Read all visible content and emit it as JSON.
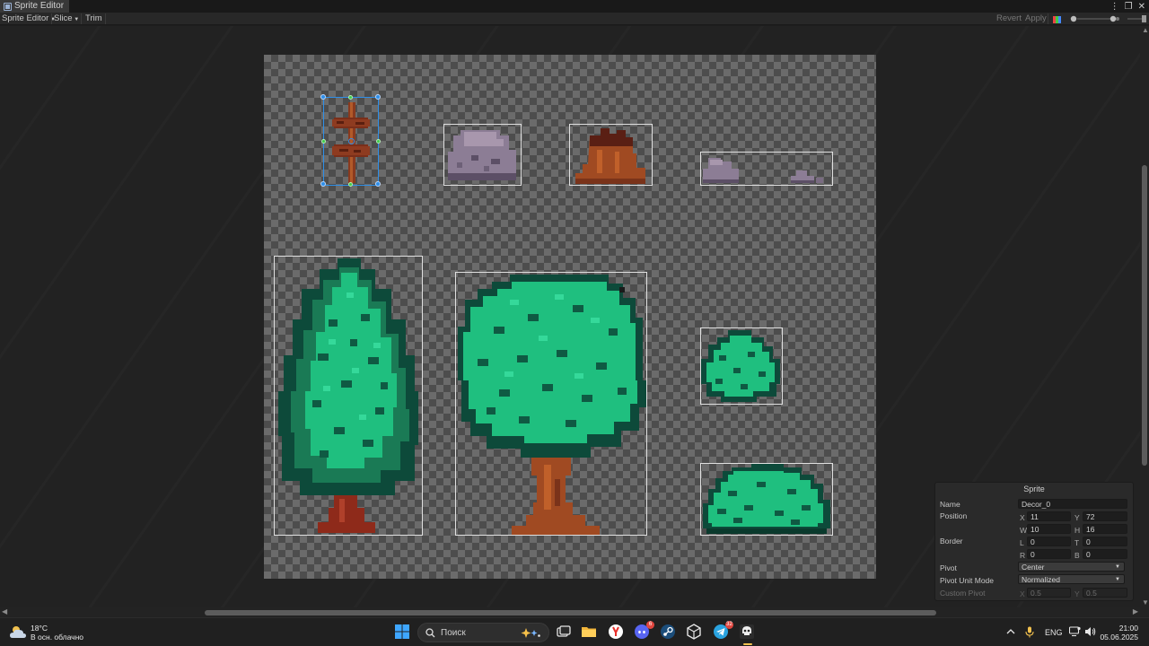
{
  "window": {
    "tab_title": "Sprite Editor",
    "controls": [
      "⋮",
      "❐",
      "✕"
    ]
  },
  "toolbar": {
    "mode_label": "Sprite Editor",
    "slice_label": "Slice",
    "trim_label": "Trim",
    "revert_label": "Revert",
    "apply_label": "Apply"
  },
  "sprite_panel": {
    "title": "Sprite",
    "name_label": "Name",
    "name_value": "Decor_0",
    "position_label": "Position",
    "x_axis": "X",
    "x_value": "11",
    "y_axis": "Y",
    "y_value": "72",
    "w_axis": "W",
    "w_value": "10",
    "h_axis": "H",
    "h_value": "16",
    "border_label": "Border",
    "l_axis": "L",
    "l_value": "0",
    "t_axis": "T",
    "t_value": "0",
    "r_axis": "R",
    "r_value": "0",
    "b_axis": "B",
    "b_value": "0",
    "pivot_label": "Pivot",
    "pivot_value": "Center",
    "pivot_unit_label": "Pivot Unit Mode",
    "pivot_unit_value": "Normalized",
    "custom_pivot_label": "Custom Pivot",
    "cp_x_axis": "X",
    "cp_x_value": "0.5",
    "cp_y_axis": "Y",
    "cp_y_value": "0.5"
  },
  "taskbar": {
    "weather_temp": "18°C",
    "weather_desc": "В осн. облачно",
    "search_placeholder": "Поиск",
    "discord_badge": "6",
    "telegram_badge": "32",
    "language": "ENG",
    "time": "21:00",
    "date": "05.06.2025"
  },
  "colors": {
    "selection": "#2e8fe8",
    "tree_light": "#1fbf7f",
    "tree_dark": "#0d4a3a",
    "trunk": "#a04a22",
    "rock": "#8a7a92"
  }
}
